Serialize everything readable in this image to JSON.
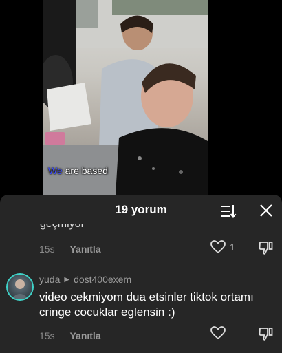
{
  "video": {
    "caption_highlight": "We",
    "caption_rest": " are based"
  },
  "comments_sheet": {
    "title": "19 yorum",
    "sort_icon": "sort-icon",
    "close_icon": "close-icon"
  },
  "comments": [
    {
      "text_partial": "geçmiyor",
      "time": "15s",
      "reply_label": "Yanıtla",
      "likes": "1"
    },
    {
      "author": "yuda",
      "reply_to": "dost400exem",
      "text": "video cekmiyom dua etsinler tiktok ortamı cringe cocuklar eglensin :)",
      "time": "15s",
      "reply_label": "Yanıtla",
      "likes": ""
    }
  ],
  "colors": {
    "sheet_bg": "#262626",
    "avatar_ring": "#3fd3c8",
    "caption_highlight": "#3b4bff"
  }
}
